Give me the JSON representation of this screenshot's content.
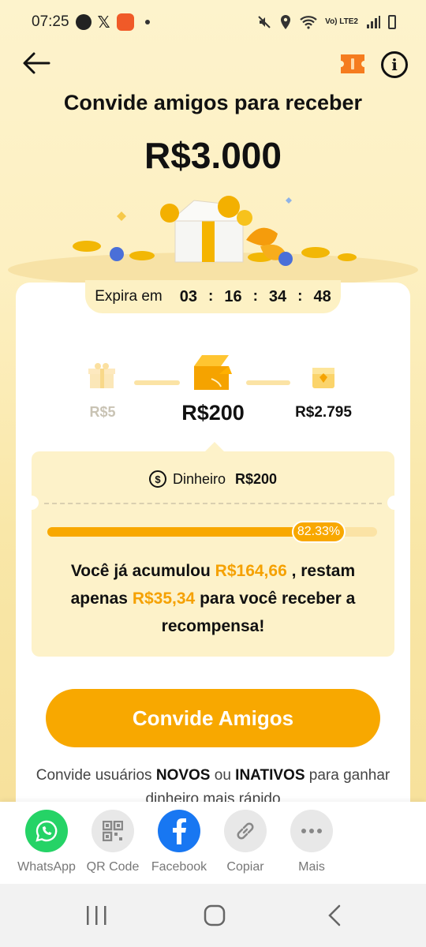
{
  "status_bar": {
    "time": "07:25",
    "network": "Vo) LTE2"
  },
  "header": {
    "title": "Convide amigos para receber",
    "amount": "R$3.000"
  },
  "timer": {
    "label": "Expira em",
    "hours": "03",
    "minutes": "16",
    "seconds": "34",
    "centiseconds": "48",
    "separator": ":"
  },
  "steps": [
    {
      "label": "R$5",
      "state": "done"
    },
    {
      "label": "R$200",
      "state": "current"
    },
    {
      "label": "R$2.795",
      "state": "next"
    }
  ],
  "reward": {
    "cash_label": "Dinheiro",
    "cash_value": "R$200",
    "progress_percent": 82.33,
    "progress_text": "82.33%",
    "msg_part1": "Você já acumulou ",
    "accumulated": "R$164,66",
    "msg_part2": " , restam apenas ",
    "remaining": "R$35,34",
    "msg_part3": " para você receber a recompensa!"
  },
  "cta": {
    "label": "Convide Amigos"
  },
  "hint": {
    "part1": "Convide usuários ",
    "novos": "NOVOS",
    "part2": " ou ",
    "inativos": "INATIVOS",
    "part3": " para ganhar dinheiro mais rápido"
  },
  "share": [
    {
      "label": "WhatsApp",
      "icon": "whatsapp-icon",
      "color": "#25d366"
    },
    {
      "label": "QR Code",
      "icon": "qr-code-icon",
      "color": "#e8e8e8"
    },
    {
      "label": "Facebook",
      "icon": "facebook-icon",
      "color": "#1877f2"
    },
    {
      "label": "Copiar",
      "icon": "link-icon",
      "color": "#e8e8e8"
    },
    {
      "label": "Mais",
      "icon": "more-icon",
      "color": "#e8e8e8"
    }
  ],
  "colors": {
    "accent": "#f8a800",
    "highlight": "#f5a100",
    "background": "#fdf1c4"
  }
}
